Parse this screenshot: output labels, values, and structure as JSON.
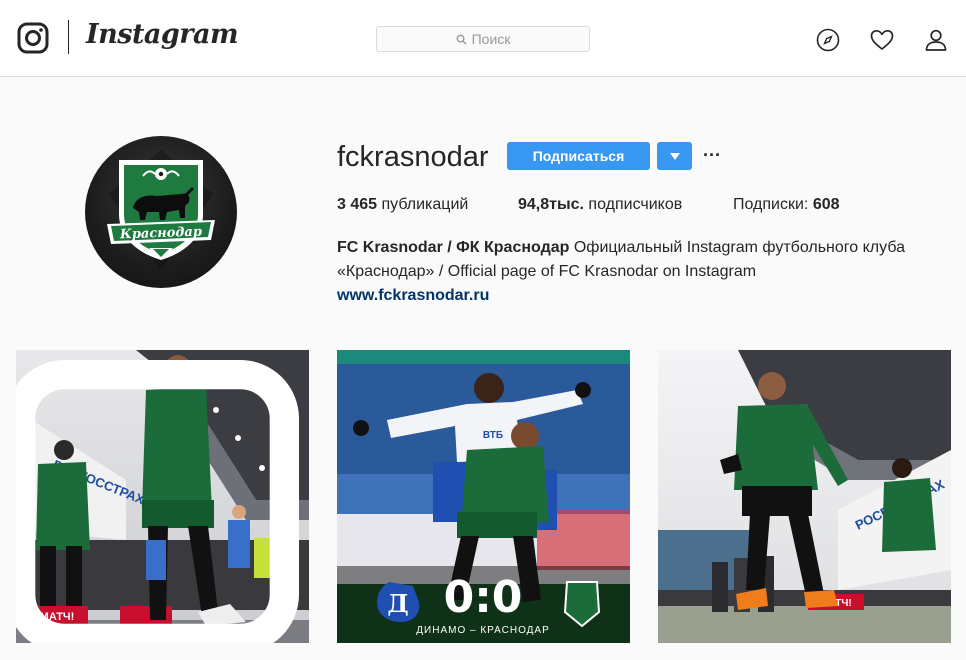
{
  "topbar": {
    "brand": "Instagram",
    "search_placeholder": "Поиск",
    "icons": [
      "instagram-camera-icon",
      "compass-icon",
      "heart-icon",
      "person-icon"
    ]
  },
  "profile": {
    "username": "fckrasnodar",
    "follow_label": "Подписаться",
    "more_label": "···",
    "stats": {
      "posts_count": "3 465",
      "posts_label": " публикаций",
      "followers_count": "94,8тыс.",
      "followers_label": " подписчиков",
      "following_label": "Подписки: ",
      "following_count": "608"
    },
    "bio": {
      "name": "FC Krasnodar / ФК Краснодар",
      "text": " Официальный Instagram футбольного клуба «Краснодар» / Official page of FC Krasnodar on Instagram",
      "link": "www.fckrasnodar.ru"
    },
    "avatar_logo_text": "Краснодар"
  },
  "posts": [
    {
      "name": "post-1",
      "has_multiple": true,
      "banner_text": "МАТЧ!",
      "wall_text": "РОСГОССТРАХ"
    },
    {
      "name": "post-2",
      "has_multiple": false,
      "score": "0:0",
      "caption": "ДИНАМО – КРАСНОДАР",
      "shirt_text": "ВТБ"
    },
    {
      "name": "post-3",
      "has_multiple": false,
      "banner_text": "МАТЧ!",
      "wall_text": "РОСГОССТРАХ"
    }
  ],
  "colors": {
    "accent": "#3897f0",
    "link": "#003569",
    "club_green": "#1f7a3f",
    "border": "#dbdbdb"
  }
}
